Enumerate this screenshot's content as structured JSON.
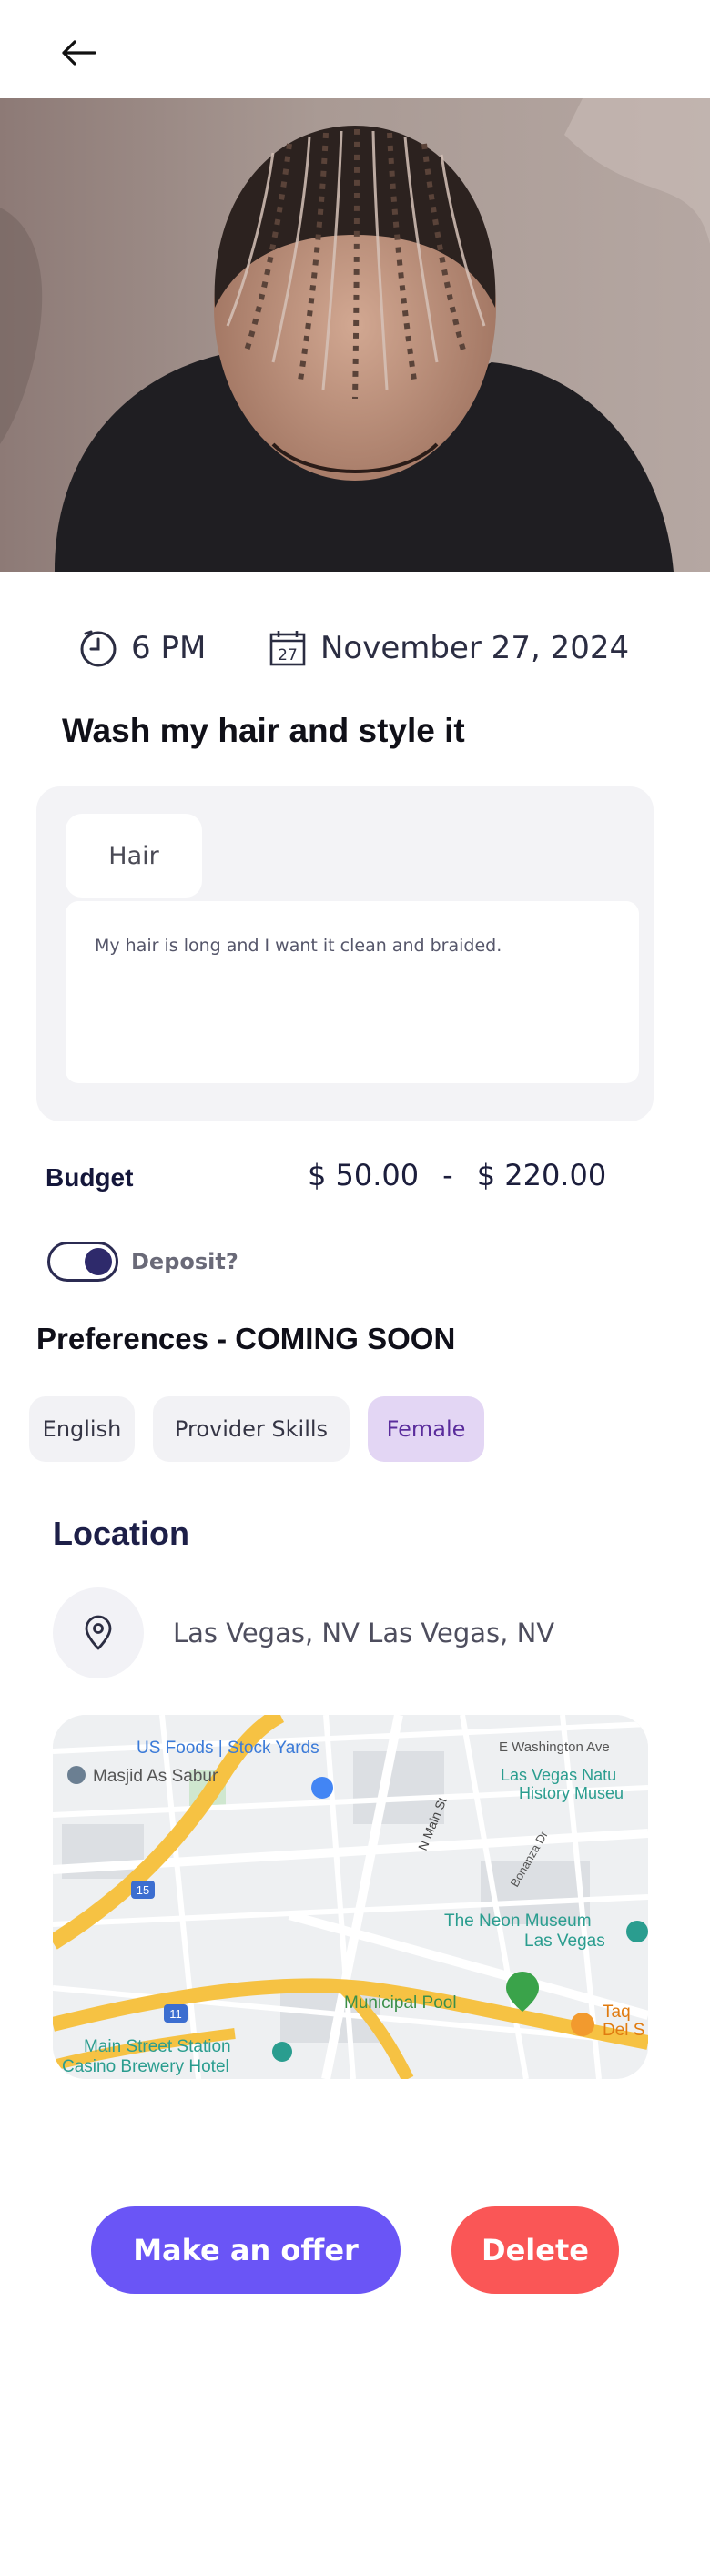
{
  "header": {
    "back_icon": "arrow-left-icon"
  },
  "hero": {
    "image_alt": "man with braided cornrows hairstyle"
  },
  "schedule": {
    "time": "6 PM",
    "date": "November 27, 2024",
    "time_icon": "clock-icon",
    "date_icon": "calendar-icon",
    "calendar_day": "27"
  },
  "request": {
    "title": "Wash my hair and style it",
    "category": "Hair",
    "description": "My hair is long and I want it clean and braided."
  },
  "budget": {
    "label": "Budget",
    "min": "$ 50.00",
    "separator": "-",
    "max": "$ 220.00"
  },
  "deposit": {
    "label": "Deposit?",
    "enabled": true
  },
  "preferences": {
    "title": "Preferences - COMING SOON",
    "chips": [
      {
        "label": "English",
        "selected": false
      },
      {
        "label": "Provider Skills",
        "selected": false
      },
      {
        "label": "Female",
        "selected": true
      }
    ]
  },
  "location": {
    "title": "Location",
    "address": "Las Vegas, NV Las Vegas, NV",
    "pin_icon": "map-pin-icon",
    "map_labels": {
      "us_foods": "US Foods | Stock Yards",
      "washington": "E Washington Ave",
      "masjid": "Masjid As Sabur",
      "museum_nat1": "Las Vegas Natu",
      "museum_nat2": "History Museu",
      "main_st": "N Main St",
      "neon1": "The Neon Museum",
      "neon2": "Las Vegas",
      "pool": "Municipal Pool",
      "taco1": "Taq",
      "taco2": "Del S",
      "station1": "Main Street Station",
      "station2": "Casino Brewery Hotel",
      "i15": "15",
      "i11": "11",
      "bonanza": "Bonanza Dr"
    }
  },
  "actions": {
    "offer_label": "Make an offer",
    "delete_label": "Delete"
  },
  "colors": {
    "primary": "#6a55f6",
    "danger": "#fa5656",
    "chip_selected_bg": "#e3d6f4",
    "chip_selected_text": "#5a2c9c",
    "toggle_knob": "#2e2a6b"
  }
}
